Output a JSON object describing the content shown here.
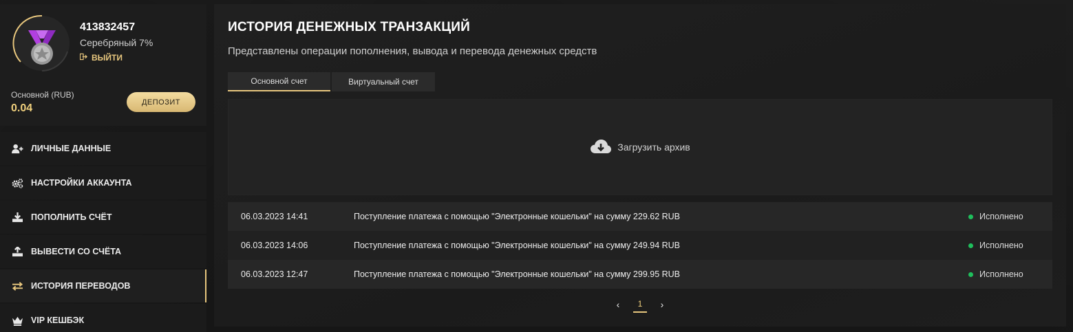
{
  "profile": {
    "user_id": "413832457",
    "level": "Серебряный 7%",
    "logout_label": "ВЫЙТИ",
    "balance_label": "Основной (RUB)",
    "balance_value": "0.04",
    "deposit_label": "ДЕПОЗИТ",
    "avatar_icon": "silver-medal-icon",
    "accent_color": "#e8c77e"
  },
  "menu": {
    "items": [
      {
        "label": "ЛИЧНЫЕ ДАННЫЕ",
        "icon": "user-plus-icon"
      },
      {
        "label": "НАСТРОЙКИ АККАУНТА",
        "icon": "gears-icon"
      },
      {
        "label": "ПОПОЛНИТЬ СЧЁТ",
        "icon": "download-icon"
      },
      {
        "label": "ВЫВЕСТИ СО СЧЁТА",
        "icon": "upload-icon"
      },
      {
        "label": "ИСТОРИЯ ПЕРЕВОДОВ",
        "icon": "transfer-arrows-icon",
        "active": true
      },
      {
        "label": "VIP КЕШБЭК",
        "icon": "crown-icon"
      }
    ]
  },
  "main": {
    "title": "ИСТОРИЯ ДЕНЕЖНЫХ ТРАНЗАКЦИЙ",
    "subtitle": "Представлены операции пополнения, вывода и перевода денежных средств",
    "tabs": [
      {
        "label": "Основной счет",
        "active": true
      },
      {
        "label": "Виртуальный счет",
        "active": false
      }
    ],
    "archive_label": "Загрузить архив",
    "transactions": [
      {
        "date": "06.03.2023 14:41",
        "description": "Поступление платежа с помощью \"Электронные кошельки\" на сумму 229.62 RUB",
        "status": "Исполнено"
      },
      {
        "date": "06.03.2023 14:06",
        "description": "Поступление платежа с помощью \"Электронные кошельки\" на сумму 249.94 RUB",
        "status": "Исполнено"
      },
      {
        "date": "06.03.2023 12:47",
        "description": "Поступление платежа с помощью \"Электронные кошельки\" на сумму 299.95 RUB",
        "status": "Исполнено"
      }
    ],
    "status_color": "#1fbf5c",
    "pagination": {
      "current_page": "1"
    }
  }
}
